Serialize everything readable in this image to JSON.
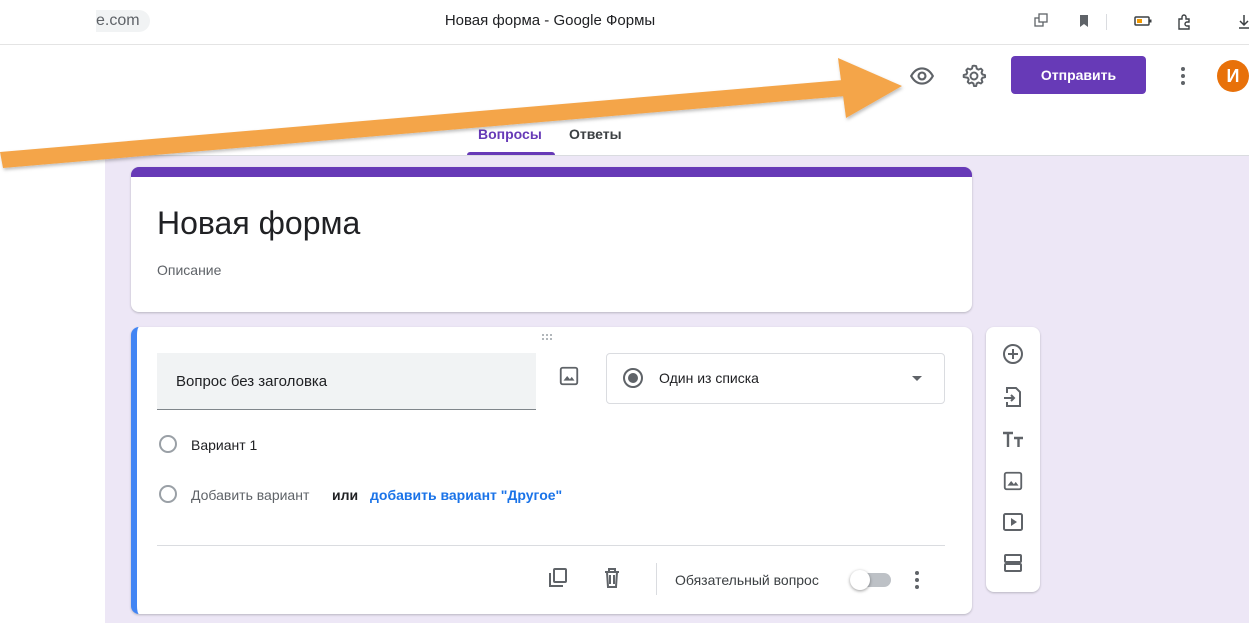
{
  "browser": {
    "url_fragment": "e.com",
    "tab_title": "Новая форма - Google Формы"
  },
  "toolbar": {
    "send_label": "Отправить",
    "avatar_letter": "И",
    "icons": [
      "eye-icon",
      "gear-icon",
      "more-vert-icon"
    ]
  },
  "tabs": [
    {
      "label": "Вопросы",
      "active": true
    },
    {
      "label": "Ответы",
      "active": false
    }
  ],
  "form": {
    "title": "Новая форма",
    "description": "Описание"
  },
  "question": {
    "title": "Вопрос без заголовка",
    "type_label": "Один из списка",
    "options": [
      "Вариант 1"
    ],
    "add_option": "Добавить вариант",
    "or_text": "или",
    "add_other": "добавить вариант \"Другое\"",
    "required_label": "Обязательный вопрос",
    "required": false
  },
  "sidebar_tools": [
    "add-question-icon",
    "import-icon",
    "title-text-icon",
    "image-icon",
    "video-icon",
    "section-icon"
  ],
  "colors": {
    "accent": "#673ab7",
    "focus_bar": "#4285f4",
    "annotation_arrow": "#f4a54a",
    "avatar": "#e8710a",
    "background": "#ede7f6"
  }
}
